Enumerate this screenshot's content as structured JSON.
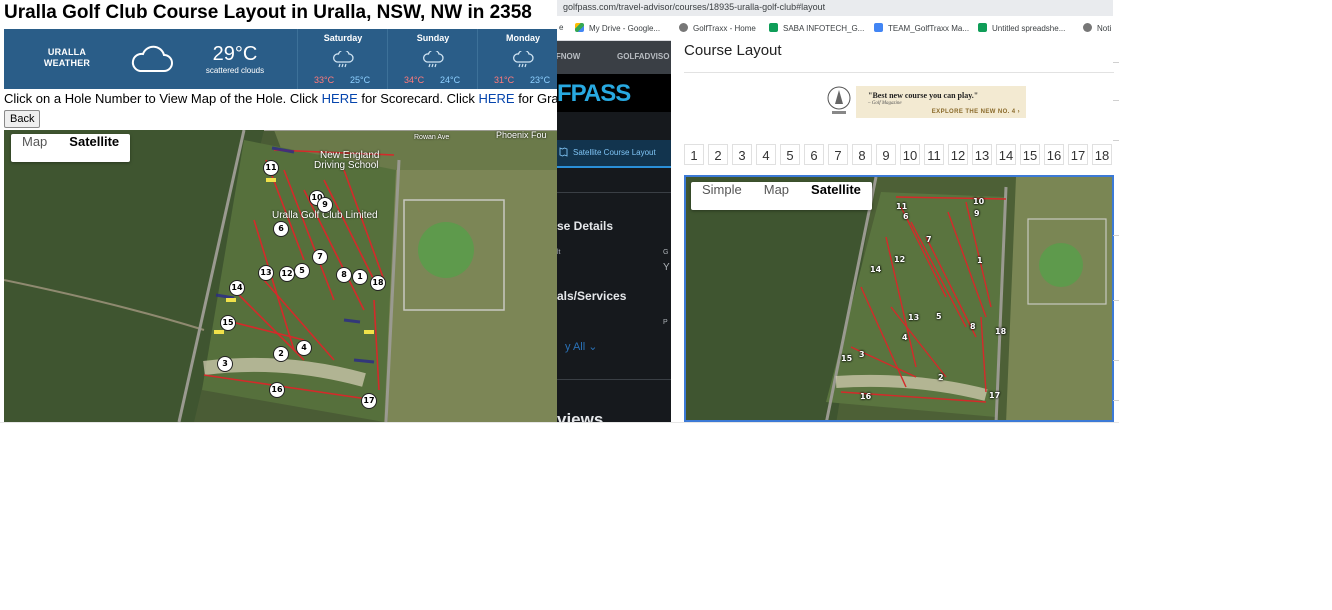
{
  "left": {
    "title": "Uralla Golf Club Course Layout in Uralla, NSW, NW in 2358",
    "weather": {
      "location_line1": "URALLA",
      "location_line2": "WEATHER",
      "current_temp": "29°C",
      "condition": "scattered clouds",
      "icon": "cloud-icon",
      "forecast": [
        {
          "day": "Saturday",
          "high": "33°C",
          "low": "25°C",
          "icon": "rain-cloud-icon"
        },
        {
          "day": "Sunday",
          "high": "34°C",
          "low": "24°C",
          "icon": "rain-cloud-icon"
        },
        {
          "day": "Monday",
          "high": "31°C",
          "low": "23°C",
          "icon": "rain-cloud-icon"
        }
      ]
    },
    "instructions": {
      "part1": "Click on a Hole Number to View Map of the Hole. Click ",
      "link1": "HERE",
      "part2": " for Scorecard. Click ",
      "link2": "HERE",
      "part3": " for Gradeb"
    },
    "back_label": "Back",
    "map": {
      "toggle": [
        "Map",
        "Satellite"
      ],
      "active": "Satellite",
      "labels": [
        "New England",
        "Driving School",
        "Phoenix Fou",
        "Rowan Ave",
        "Uralla Golf Club Limited"
      ],
      "holes": [
        "10",
        "7",
        "13",
        "12",
        "5",
        "8",
        "1",
        "18",
        "15",
        "2",
        "4",
        "3",
        "16",
        "17",
        "11",
        "14",
        "9",
        "6"
      ]
    }
  },
  "middle": {
    "url": "golfpass.com/travel-advisor/courses/18935-uralla-golf-club#layout",
    "bookmarks": [
      "My Drive - Google...",
      "GolfTraxx - Home",
      "SABA INFOTECH_G...",
      "TEAM_GolfTraxx Ma...",
      "Untitled spreadshe...",
      "Noti"
    ],
    "nav_items": [
      "LFNOW",
      "GOLFADVISO"
    ],
    "logo": "FPASS",
    "tab": "Satellite Course Layout",
    "heading1": "se Details",
    "heading2": "als/Services",
    "heading3": "views",
    "all_link": "y All",
    "small_text": [
      "lt",
      "G",
      "Y",
      "P"
    ]
  },
  "right": {
    "title": "Course Layout",
    "ad": {
      "quote": "\"Best new course you can play.\"",
      "source": "– Golf Magazine",
      "cta": "EXPLORE THE NEW NO. 4 ›"
    },
    "hole_tabs": [
      "1",
      "2",
      "3",
      "4",
      "5",
      "6",
      "7",
      "8",
      "9",
      "10",
      "11",
      "12",
      "13",
      "14",
      "15",
      "16",
      "17",
      "18"
    ],
    "map_toggle": [
      "Simple",
      "Map",
      "Satellite"
    ],
    "map_active": "Satellite",
    "holes": [
      "11",
      "6",
      "10",
      "9",
      "7",
      "12",
      "1",
      "14",
      "13",
      "5",
      "8",
      "18",
      "4",
      "15",
      "3",
      "2",
      "16",
      "17"
    ]
  }
}
